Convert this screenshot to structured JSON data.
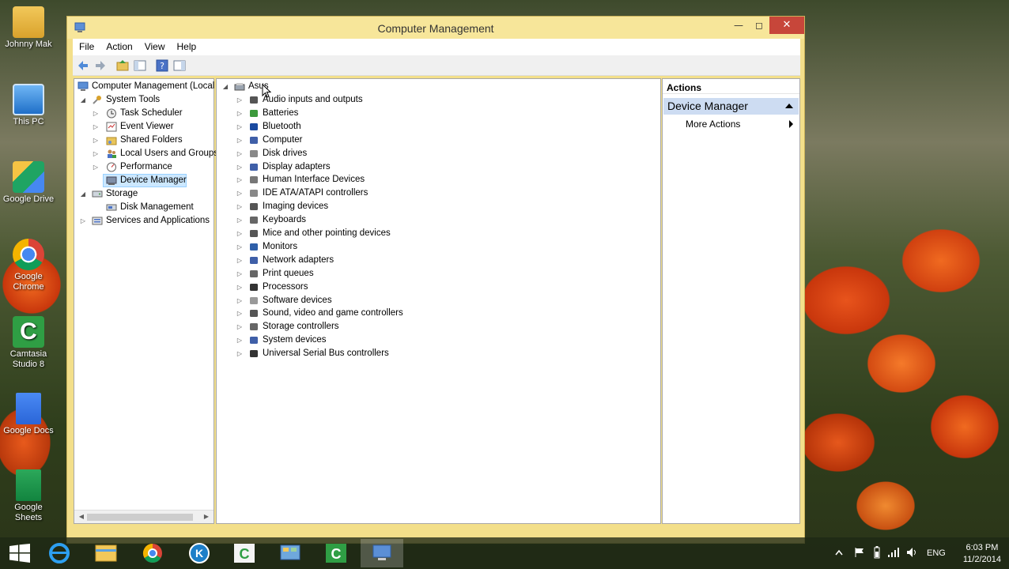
{
  "window": {
    "title": "Computer Management"
  },
  "menu": [
    "File",
    "Action",
    "View",
    "Help"
  ],
  "left_tree": {
    "root": "Computer Management (Local",
    "items": [
      {
        "label": "System Tools",
        "level": 1,
        "expanded": true,
        "icon": "tools-icon"
      },
      {
        "label": "Task Scheduler",
        "level": 2,
        "icon": "clock-icon"
      },
      {
        "label": "Event Viewer",
        "level": 2,
        "icon": "event-viewer-icon"
      },
      {
        "label": "Shared Folders",
        "level": 2,
        "icon": "shared-folder-icon"
      },
      {
        "label": "Local Users and Groups",
        "level": 2,
        "icon": "users-icon"
      },
      {
        "label": "Performance",
        "level": 2,
        "icon": "performance-icon"
      },
      {
        "label": "Device Manager",
        "level": 2,
        "icon": "device-manager-icon",
        "selected": true
      },
      {
        "label": "Storage",
        "level": 1,
        "expanded": true,
        "icon": "storage-icon"
      },
      {
        "label": "Disk Management",
        "level": 2,
        "icon": "disk-management-icon"
      },
      {
        "label": "Services and Applications",
        "level": 1,
        "icon": "services-icon"
      }
    ]
  },
  "device_tree": {
    "root": "Asus",
    "categories": [
      "Audio inputs and outputs",
      "Batteries",
      "Bluetooth",
      "Computer",
      "Disk drives",
      "Display adapters",
      "Human Interface Devices",
      "IDE ATA/ATAPI controllers",
      "Imaging devices",
      "Keyboards",
      "Mice and other pointing devices",
      "Monitors",
      "Network adapters",
      "Print queues",
      "Processors",
      "Software devices",
      "Sound, video and game controllers",
      "Storage controllers",
      "System devices",
      "Universal Serial Bus controllers"
    ]
  },
  "actions": {
    "header": "Actions",
    "group": "Device Manager",
    "more": "More Actions"
  },
  "desktop_icons": [
    "Johnny Mak",
    "This PC",
    "Google Drive",
    "Google Chrome",
    "Camtasia Studio 8",
    "Google Docs",
    "Google Sheets"
  ],
  "taskbar": {
    "lang": "ENG",
    "time": "6:03 PM",
    "date": "11/2/2014"
  },
  "colors": {
    "window_frame": "#f3df8a",
    "selected": "#cce8ff",
    "actions_group": "#cddcf2",
    "close_button": "#c7463a"
  }
}
